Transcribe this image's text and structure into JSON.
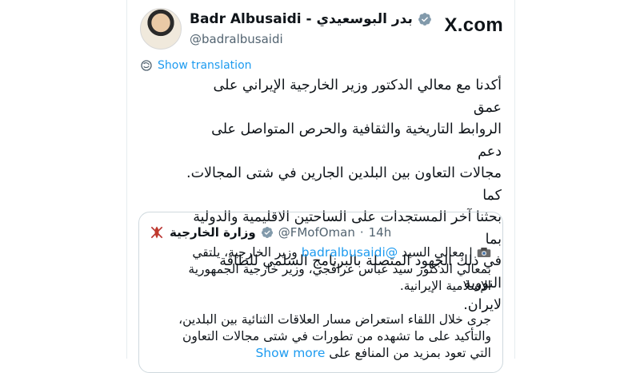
{
  "brand": "X.com",
  "author": {
    "display_name": "Badr Albusaidi - بدر البوسعيدي",
    "handle": "@badralbusaidi"
  },
  "translate_label": "Show translation",
  "tweet_lines": [
    "أكدنا مع معالي الدكتور وزير الخارجية الإيراني على عمق",
    "الروابط التاريخية والثقافية والحرص المتواصل على دعم",
    "مجالات التعاون بين البلدين الجارين في شتى المجالات. كما",
    "بحثنا آخر المستجدات على الساحتين الاقليمية والدولية بما",
    "في ذلك الجهود المتصلة بالبرنامج السلمي للطاقة النووية",
    "لايران."
  ],
  "quote": {
    "name": "وزارة الخارجية",
    "handle": "@FMofOman",
    "separator": "·",
    "time": "14h",
    "line1_before": " | معالي السيد ",
    "line1_mention": "@badralbusaidi",
    "line1_after": " وزير الخارجية، يلتقي",
    "line2": "بمعالي الدكتور سيد عباس عراقجي، وزير خارجية الجمهورية",
    "line3": "الإسلامية الإيرانية.",
    "line4": "جرى خلال اللقاء استعراض مسار العلاقات الثنائية بين البلدين،",
    "line5": "والتأكيد على ما تشهده من تطورات في شتى مجالات التعاون",
    "line6": "التي تعود بمزيد من المنافع على",
    "show_more": "Show more"
  },
  "icons": {
    "verified": "verified-badge-icon",
    "globe": "globe-icon",
    "camera": "camera-icon",
    "emblem": "oman-emblem-icon"
  },
  "colors": {
    "accent": "#1d9bf0",
    "text": "#0f1419",
    "muted": "#536471",
    "border": "#cfd9de"
  }
}
